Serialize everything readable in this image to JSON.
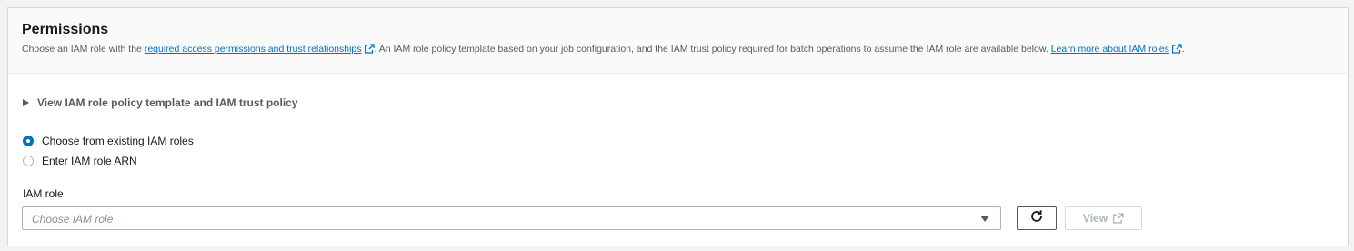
{
  "permissions": {
    "title": "Permissions",
    "description": {
      "part1": "Choose an IAM role with the ",
      "link1": "required access permissions and trust relationships",
      "part2": ". An IAM role policy template based on your job configuration, and the IAM trust policy required for batch operations to assume the IAM role are available below. ",
      "link2": "Learn more about IAM roles",
      "part3": "."
    },
    "expander_label": "View IAM role policy template and IAM trust policy",
    "radio_options": [
      {
        "label": "Choose from existing IAM roles",
        "selected": true
      },
      {
        "label": "Enter IAM role ARN",
        "selected": false
      }
    ],
    "iam_role": {
      "label": "IAM role",
      "placeholder": "Choose IAM role",
      "view_button": "View"
    }
  },
  "colors": {
    "link": "#0073bb",
    "radio_selected": "#0073bb",
    "disabled_text": "#aab7b8"
  },
  "icons": {
    "external_link": "external-link-icon",
    "refresh": "refresh-icon",
    "caret": "caret-right-icon",
    "dropdown": "caret-down-icon"
  }
}
